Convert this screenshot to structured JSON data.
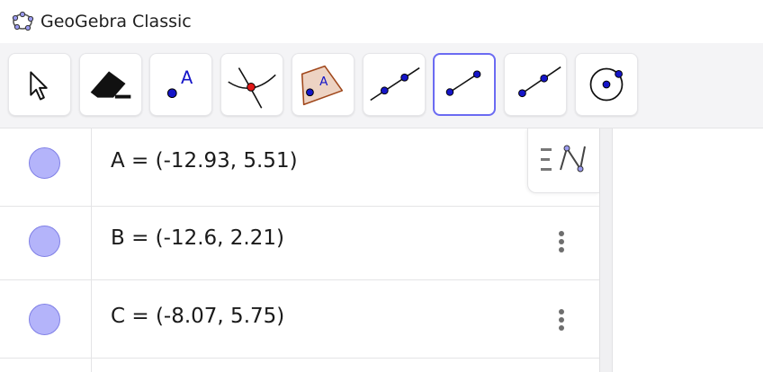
{
  "app": {
    "title": "GeoGebra Classic",
    "logo_icon": "geogebra-logo-icon"
  },
  "toolbar": {
    "tools": [
      {
        "name": "move-tool",
        "icon": "arrow-cursor-icon",
        "selected": false
      },
      {
        "name": "delete-tool",
        "icon": "eraser-icon",
        "selected": false
      },
      {
        "name": "point-tool",
        "icon": "point-icon",
        "label": "A",
        "selected": false
      },
      {
        "name": "intersect-tool",
        "icon": "intersect-icon",
        "selected": false
      },
      {
        "name": "polygon-tool",
        "icon": "polygon-icon",
        "label": "A",
        "selected": false
      },
      {
        "name": "line-tool",
        "icon": "line-icon",
        "selected": false
      },
      {
        "name": "segment-tool",
        "icon": "segment-icon",
        "selected": true
      },
      {
        "name": "ray-tool",
        "icon": "ray-icon",
        "selected": false
      },
      {
        "name": "circle-tool",
        "icon": "circle-icon",
        "selected": false
      }
    ],
    "accent_color": "#6b6bf2"
  },
  "algebra": {
    "point_color": "#b4b4fa",
    "rows": [
      {
        "label": "A = (-12.93, 5.51)"
      },
      {
        "label": "B = (-12.6, 2.21)"
      },
      {
        "label": "C = (-8.07, 5.75)"
      }
    ],
    "style_toggle_icon": "algebra-description-toggle-icon",
    "more_icon": "more-vertical-icon"
  }
}
